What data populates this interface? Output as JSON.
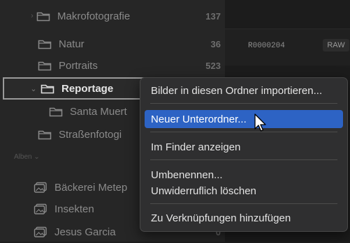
{
  "sidebar": {
    "folders": [
      {
        "label": "Makrofotografie",
        "count": "137"
      },
      {
        "label": "Natur",
        "count": "36"
      },
      {
        "label": "Portraits",
        "count": "523"
      },
      {
        "label": "Reportage",
        "count": ""
      },
      {
        "label": "Santa Muert",
        "count": ""
      },
      {
        "label": "Straßenfotogi",
        "count": ""
      }
    ],
    "section_header": "Alben ⌄",
    "albums": [
      {
        "label": "Bäckerei Metep",
        "count": ""
      },
      {
        "label": "Insekten",
        "count": ""
      },
      {
        "label": "Jesus Garcia",
        "count": "0"
      }
    ]
  },
  "content": {
    "filename": "R0000204",
    "badge": "RAW"
  },
  "context_menu": {
    "items": [
      {
        "label": "Bilder in diesen Ordner importieren..."
      },
      {
        "label": "Neuer Unterordner..."
      },
      {
        "label": "Im Finder anzeigen"
      },
      {
        "label": "Umbenennen..."
      },
      {
        "label": "Unwiderruflich löschen"
      },
      {
        "label": "Zu Verknüpfungen hinzufügen"
      }
    ],
    "highlighted_index": 1,
    "highlight_color": "#2d63c4"
  },
  "icons": {
    "folder": "folder-icon",
    "album": "album-icon",
    "chevron": "chevron-icon",
    "cursor": "mouse-pointer-icon"
  }
}
